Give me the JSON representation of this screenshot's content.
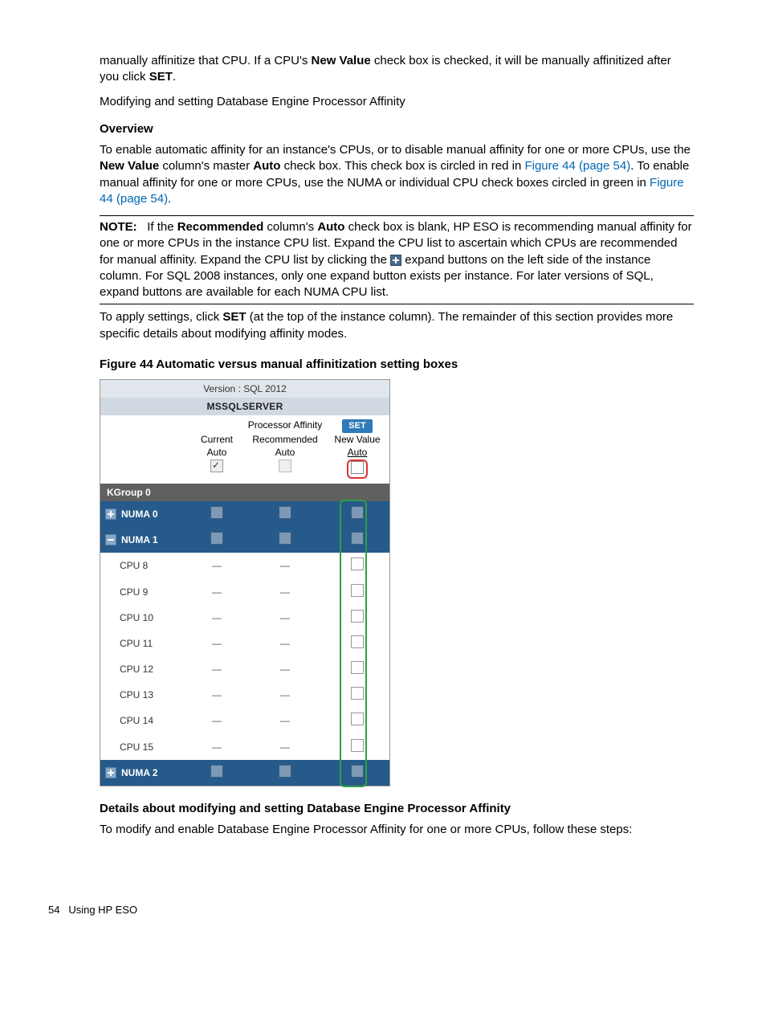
{
  "intro": {
    "p1a": "manually affinitize that CPU. If a CPU's ",
    "p1b": "New Value",
    "p1c": " check box is checked, it will be manually affinitized after you click ",
    "p1d": "SET",
    "p1e": ".",
    "p2": "Modifying and setting Database Engine Processor Affinity"
  },
  "overview": {
    "heading": "Overview",
    "p1a": "To enable automatic affinity for an instance's CPUs, or to disable manual affinity for one or more CPUs, use the ",
    "p1b": "New Value",
    "p1c": " column's master ",
    "p1d": "Auto",
    "p1e": " check box. This check box is circled in red in ",
    "link1": "Figure 44 (page 54)",
    "p1f": ". To enable manual affinity for one or more CPUs, use the NUMA or individual CPU check boxes circled in green in ",
    "link2": "Figure 44 (page 54)",
    "p1g": "."
  },
  "note": {
    "label": "NOTE:",
    "a": "If the ",
    "b": "Recommended",
    "c": " column's ",
    "d": "Auto",
    "e": " check box is blank, HP ESO is recommending manual affinity for one or more CPUs in the instance CPU list. Expand the CPU list to ascertain which CPUs are recommended for manual affinity. Expand the CPU list by clicking the ",
    "f": " expand buttons on the left side of the instance column. For SQL 2008 instances, only one expand button exists per instance. For later versions of SQL, expand buttons are available for each NUMA CPU list."
  },
  "apply": {
    "a": "To apply settings, click ",
    "b": "SET",
    "c": " (at the top of the instance column). The remainder of this section provides more specific details about modifying affinity modes."
  },
  "figure": {
    "caption": "Figure 44 Automatic versus manual affinitization setting boxes",
    "version": "Version : SQL 2012",
    "server": "MSSQLSERVER",
    "pa_label": "Processor Affinity",
    "set": "SET",
    "col_current": "Current",
    "col_rec": "Recommended",
    "col_new": "New Value",
    "auto": "Auto",
    "kgroup": "KGroup 0",
    "numa0": "NUMA 0",
    "numa1": "NUMA 1",
    "numa2": "NUMA 2",
    "cpus": [
      "CPU 8",
      "CPU 9",
      "CPU 10",
      "CPU 11",
      "CPU 12",
      "CPU 13",
      "CPU 14",
      "CPU 15"
    ]
  },
  "details": {
    "heading": "Details about modifying and setting Database Engine Processor Affinity",
    "p": "To modify and enable Database Engine Processor Affinity for one or more CPUs, follow these steps:"
  },
  "footer": {
    "page": "54",
    "section": "Using HP ESO"
  }
}
